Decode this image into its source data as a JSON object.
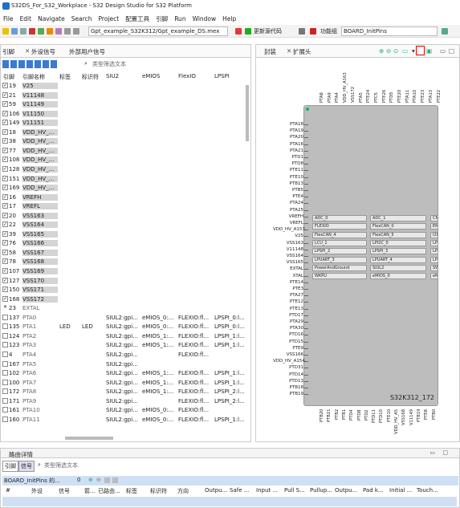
{
  "app": {
    "title": "S32DS_For_S32_Workplace - S32 Design Studio for S32 Platform"
  },
  "menu": [
    "File",
    "Edit",
    "Navigate",
    "Search",
    "Project",
    "配置工具",
    "引脚",
    "Run",
    "Window",
    "Help"
  ],
  "toolbar": {
    "file_combo": "Gpt_example_S32K312/Gpt_example_DS.mex",
    "update_code": "更新源代码",
    "function_group_label": "功能组",
    "function_group": "BOARD_InitPins"
  },
  "left_panel": {
    "tabs": [
      "引脚",
      "外设信号",
      "外部用户信号"
    ],
    "filter_placeholder": "类型筛选文本",
    "headers": [
      "引脚",
      "引脚名称",
      "标签",
      "标识符",
      "SIU2",
      "eMIOS",
      "FlexIO",
      "LPSPI"
    ],
    "rows": [
      {
        "n": "19",
        "name": "V25",
        "checked": true,
        "gray": true
      },
      {
        "n": "21",
        "name": "V11148",
        "checked": true,
        "gray": true
      },
      {
        "n": "59",
        "name": "V11149",
        "checked": true,
        "gray": true
      },
      {
        "n": "106",
        "name": "V11150",
        "checked": true,
        "gray": true
      },
      {
        "n": "149",
        "name": "V11151",
        "checked": true,
        "gray": true
      },
      {
        "n": "18",
        "name": "VDD_HV_...",
        "checked": true,
        "gray": true
      },
      {
        "n": "38",
        "name": "VDD_HV_...",
        "checked": true,
        "gray": true
      },
      {
        "n": "77",
        "name": "VDD_HV_...",
        "checked": true,
        "gray": true
      },
      {
        "n": "108",
        "name": "VDD_HV_...",
        "checked": true,
        "gray": true
      },
      {
        "n": "128",
        "name": "VDD_HV_...",
        "checked": true,
        "gray": true
      },
      {
        "n": "151",
        "name": "VDD_HV_...",
        "checked": true,
        "gray": true
      },
      {
        "n": "169",
        "name": "VDD_HV_...",
        "checked": true,
        "gray": true
      },
      {
        "n": "16",
        "name": "VREFH",
        "checked": true,
        "gray": true
      },
      {
        "n": "17",
        "name": "VREFL",
        "checked": true,
        "gray": true
      },
      {
        "n": "20",
        "name": "VSS163",
        "checked": true,
        "gray": true
      },
      {
        "n": "22",
        "name": "VSS164",
        "checked": true,
        "gray": true
      },
      {
        "n": "39",
        "name": "VSS165",
        "checked": true,
        "gray": true
      },
      {
        "n": "76",
        "name": "VSS166",
        "checked": true,
        "gray": true
      },
      {
        "n": "58",
        "name": "VSS167",
        "checked": true,
        "gray": true
      },
      {
        "n": "78",
        "name": "VSS168",
        "checked": true,
        "gray": true
      },
      {
        "n": "107",
        "name": "VSS169",
        "checked": true,
        "gray": true
      },
      {
        "n": "127",
        "name": "VSS170",
        "checked": true,
        "gray": true
      },
      {
        "n": "150",
        "name": "VSS171",
        "checked": true,
        "gray": true
      },
      {
        "n": "168",
        "name": "VSS172",
        "checked": true,
        "gray": true
      },
      {
        "n": "23",
        "name": "EXTAL",
        "mark": "✕",
        "gray": false
      },
      {
        "n": "137",
        "name": "PTA0",
        "label": "",
        "ident": "",
        "siu": "SIUL2:gpi...",
        "emios": "eMIOS_0:...",
        "flexio": "FLEXIO:fl...",
        "lpspi": "LPSPI_0:l..."
      },
      {
        "n": "135",
        "name": "PTA1",
        "label": "LED",
        "ident": "LED",
        "siu": "SIUL2:gpi...",
        "emios": "eMIOS_0:...",
        "flexio": "FLEXIO:fl...",
        "lpspi": "LPSPI_0:l..."
      },
      {
        "n": "124",
        "name": "PTA2",
        "siu": "SIUL2:gpi...",
        "emios": "eMIOS_1:...",
        "flexio": "FLEXIO:fl...",
        "lpspi": "LPSPI_1:l..."
      },
      {
        "n": "123",
        "name": "PTA3",
        "siu": "SIUL2:gpi...",
        "emios": "eMIOS_1:...",
        "flexio": "FLEXIO:fl...",
        "lpspi": "LPSPI_1:l..."
      },
      {
        "n": "4",
        "name": "PTA4",
        "siu": "SIUL2:gpi...",
        "emios": "",
        "flexio": "FLEXIO:fl...",
        "lpspi": ""
      },
      {
        "n": "167",
        "name": "PTA5",
        "siu": "SIUL2:gpi...",
        "emios": "",
        "flexio": "",
        "lpspi": ""
      },
      {
        "n": "102",
        "name": "PTA6",
        "siu": "SIUL2:gpi...",
        "emios": "eMIOS_1:...",
        "flexio": "FLEXIO:fl...",
        "lpspi": "LPSPI_1:l..."
      },
      {
        "n": "100",
        "name": "PTA7",
        "siu": "SIUL2:gpi...",
        "emios": "eMIOS_1:...",
        "flexio": "FLEXIO:fl...",
        "lpspi": "LPSPI_1:l..."
      },
      {
        "n": "172",
        "name": "PTA8",
        "siu": "SIUL2:gpi...",
        "emios": "eMIOS_1:...",
        "flexio": "FLEXIO:fl...",
        "lpspi": "LPSPI_2:l..."
      },
      {
        "n": "171",
        "name": "PTA9",
        "siu": "SIUL2:gpi...",
        "emios": "",
        "flexio": "FLEXIO:fl...",
        "lpspi": "LPSPI_2:l..."
      },
      {
        "n": "161",
        "name": "PTA10",
        "siu": "SIUL2:gpi...",
        "emios": "eMIOS_0:...",
        "flexio": "FLEXIO:fl...",
        "lpspi": ""
      },
      {
        "n": "160",
        "name": "PTA11",
        "siu": "SIUL2:gpi...",
        "emios": "eMIOS_0:...",
        "flexio": "FLEXIO:fl...",
        "lpspi": "LPSPI_1:l..."
      }
    ]
  },
  "right_panel": {
    "tabs": [
      "封装",
      "扩展头"
    ],
    "chip_name": "S32K312_172",
    "left_pins": [
      "PTA18",
      "PTA19",
      "PTA20",
      "PTA16",
      "PTA21",
      "PTD1",
      "PTD8",
      "PTE11",
      "PTE10",
      "PTB13",
      "PTB5",
      "PTE4",
      "PTA24",
      "PTA25",
      "VREFH",
      "VREFL",
      "VDD_HV_A153",
      "V25",
      "VSS163",
      "V11148",
      "VSS164",
      "VSS165",
      "EXTAL",
      "XTAL",
      "PTE14",
      "PTE3",
      "PTA27",
      "PTE12",
      "PTE13",
      "PTD17",
      "PTA29",
      "PTA30",
      "PTD16",
      "PTD15",
      "PTE9",
      "VSS166",
      "VDD_HV_A154",
      "PTD31",
      "PTD14",
      "PTD13",
      "PTB18",
      "PTB19"
    ],
    "top_pins": [
      "PTA8",
      "PTA9",
      "PTA4",
      "VDD_HV_A163",
      "VSS172",
      "PTA5",
      "PTE24",
      "PTC5",
      "PTE26",
      "PTD5",
      "PTE20",
      "PTA11",
      "PTA10",
      "PTE23",
      "PTA13",
      "PTE22"
    ],
    "bottom_pins": [
      "PTB20",
      "PTB21",
      "PTB2",
      "PTB1",
      "PTD4",
      "PTD8",
      "PTD2",
      "PTD11",
      "PTD10",
      "PTE10",
      "VDD_HV_A5",
      "VSS168",
      "V11149",
      "PTB19",
      "PTE8",
      "PTB0"
    ],
    "blocks": [
      [
        "ADC_0",
        "ADC_1",
        "CM"
      ],
      [
        "FLEXIO",
        "FlexCAN_0",
        "EM"
      ],
      [
        "FlexCAN_4",
        "FlexCAN_5",
        "I2C"
      ],
      [
        "LCU_1",
        "LPI2C_0",
        "LPI"
      ],
      [
        "LPSPI_2",
        "LPSPI_3",
        "LPI"
      ],
      [
        "LPUART_3",
        "LPUART_4",
        "LPI"
      ],
      [
        "PowerAndGround",
        "SIUL2",
        "SW"
      ],
      [
        "WKPU",
        "eMIOS_0",
        "eM"
      ]
    ]
  },
  "bottom_panel": {
    "title": "路由详情",
    "tabs": [
      "引脚",
      "信号"
    ],
    "filter_placeholder": "类型筛选文本",
    "group": "BOARD_InitPins 的...",
    "count": "0",
    "headers": [
      "#",
      "外设",
      "信号",
      "箭...",
      "已路由...",
      "标签",
      "标识符",
      "方向",
      "Outpu...",
      "Safe ...",
      "Input ...",
      "Pull S...",
      "Pullup...",
      "Outpu...",
      "Pad k...",
      "Initial ...",
      "Touch..."
    ]
  }
}
